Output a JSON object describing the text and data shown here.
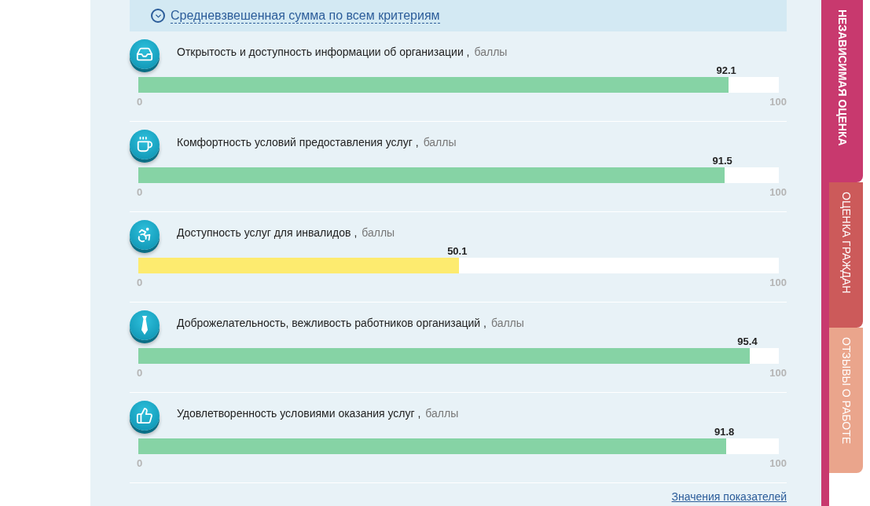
{
  "header": {
    "title": "Средневзвешенная сумма по всем критериям"
  },
  "criteria": [
    {
      "title": "Открытость и доступность информации об организации ,",
      "unit": "баллы",
      "value": "92.1",
      "level": 0.921,
      "color": "#86d3a5",
      "min": "0",
      "max": "100"
    },
    {
      "title": "Комфортность условий предоставления услуг ,",
      "unit": "баллы",
      "value": "91.5",
      "level": 0.915,
      "color": "#86d3a5",
      "min": "0",
      "max": "100"
    },
    {
      "title": "Доступность услуг для инвалидов ,",
      "unit": "баллы",
      "value": "50.1",
      "level": 0.501,
      "color": "#fdeb6f",
      "min": "0",
      "max": "100"
    },
    {
      "title": "Доброжелательность, вежливость работников организаций ,",
      "unit": "баллы",
      "value": "95.4",
      "level": 0.954,
      "color": "#86d3a5",
      "min": "0",
      "max": "100"
    },
    {
      "title": "Удовлетворенность условиями оказания услуг ,",
      "unit": "баллы",
      "value": "91.8",
      "level": 0.918,
      "color": "#86d3a5",
      "min": "0",
      "max": "100"
    }
  ],
  "footer_link": "Значения показателей",
  "side_tabs": [
    {
      "label": "НЕЗАВИСИМАЯ ОЦЕНКА",
      "selected": true,
      "color": "#c8396e"
    },
    {
      "label": "ОЦЕНКА ГРАЖДАН",
      "selected": false,
      "color": "#cc5a5a"
    },
    {
      "label": "ОТЗЫВЫ О РАБОТЕ",
      "selected": false,
      "color": "#eaa58c"
    }
  ]
}
